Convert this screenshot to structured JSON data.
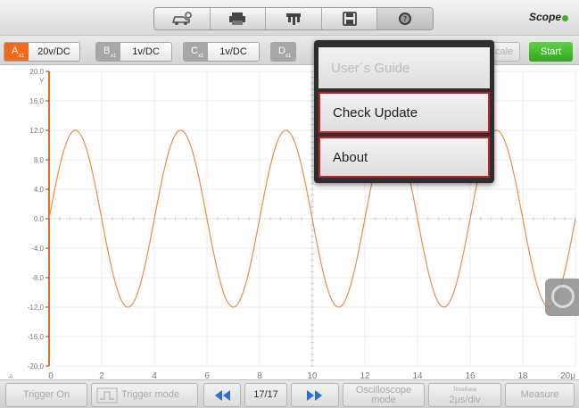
{
  "toolbar": {
    "icons": [
      "car-settings-icon",
      "printer-icon",
      "probe-icon",
      "save-icon",
      "help-icon"
    ],
    "brand": "Scope"
  },
  "channels": [
    {
      "letter": "A",
      "sub": "x1",
      "value": "20v/DC",
      "color": "#ef6a1c"
    },
    {
      "letter": "B",
      "sub": "x1",
      "value": "1v/DC",
      "color": "#a7a7a7"
    },
    {
      "letter": "C",
      "sub": "x1",
      "value": "1v/DC",
      "color": "#a7a7a7"
    },
    {
      "letter": "D",
      "sub": "x1"
    }
  ],
  "scale_label": "cale",
  "start_label": "Start",
  "help_menu": {
    "items": [
      "User´s Guide",
      "Check Update",
      "About"
    ]
  },
  "chart_data": {
    "type": "line",
    "y_unit": "V",
    "y_ticks": [
      "20.0",
      "16.0",
      "12.0",
      "8.0",
      "4.0",
      "0.0",
      "-4.0",
      "-8.0",
      "-12.0",
      "-16.0",
      "-20.0"
    ],
    "x_ticks": [
      "0",
      "2",
      "4",
      "6",
      "8",
      "10",
      "12",
      "14",
      "16",
      "18",
      "20μ"
    ],
    "xlim": [
      0,
      20
    ],
    "ylim": [
      -20,
      20
    ],
    "series": [
      {
        "color": "#f08a4b",
        "amplitude": 12,
        "period": 4,
        "phase_x": 1,
        "offset": 0
      }
    ],
    "marker_label": "A"
  },
  "bottom": {
    "trigger_on": "Trigger On",
    "trigger_mode": "Trigger mode",
    "page": "17/17",
    "osc_mode_line1": "Oscilloscope",
    "osc_mode_line2": "mode",
    "timebase_label": "TimeBase",
    "timebase_value": "2μs/div",
    "measure": "Measure"
  }
}
